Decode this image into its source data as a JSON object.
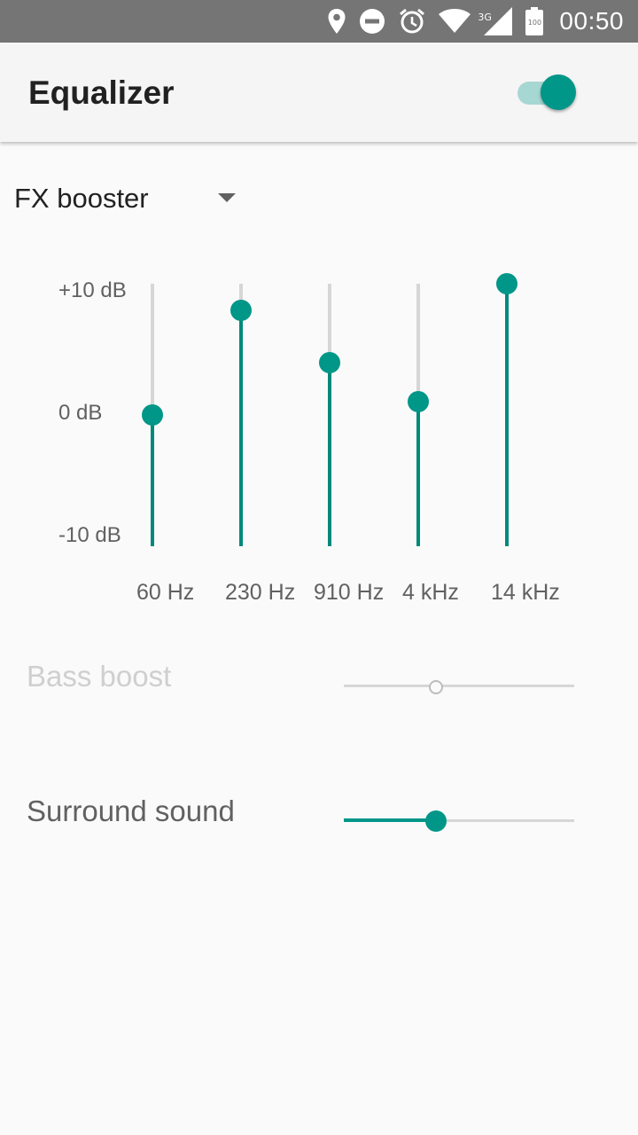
{
  "status_bar": {
    "network": "3G",
    "battery": "100",
    "time": "00:50",
    "icons": [
      "location-icon",
      "do-not-disturb-icon",
      "alarm-icon",
      "wifi-icon",
      "cell-signal-icon",
      "battery-icon"
    ]
  },
  "app_bar": {
    "title": "Equalizer",
    "enabled": true
  },
  "preset": {
    "selected": "FX booster"
  },
  "equalizer": {
    "db_labels": {
      "max": "+10 dB",
      "zero": "0 dB",
      "min": "-10 dB"
    },
    "range_db": [
      -10,
      10
    ],
    "bands": [
      {
        "label": "60 Hz",
        "db": 0
      },
      {
        "label": "230 Hz",
        "db": 8
      },
      {
        "label": "910 Hz",
        "db": 4
      },
      {
        "label": "4 kHz",
        "db": 1
      },
      {
        "label": "14 kHz",
        "db": 10
      }
    ]
  },
  "settings": [
    {
      "label": "Bass boost",
      "value": 0.4,
      "enabled": false
    },
    {
      "label": "Surround sound",
      "value": 0.4,
      "enabled": true
    }
  ],
  "colors": {
    "accent": "#009688",
    "track": "#d6d6d6",
    "status_bar": "#757575"
  }
}
